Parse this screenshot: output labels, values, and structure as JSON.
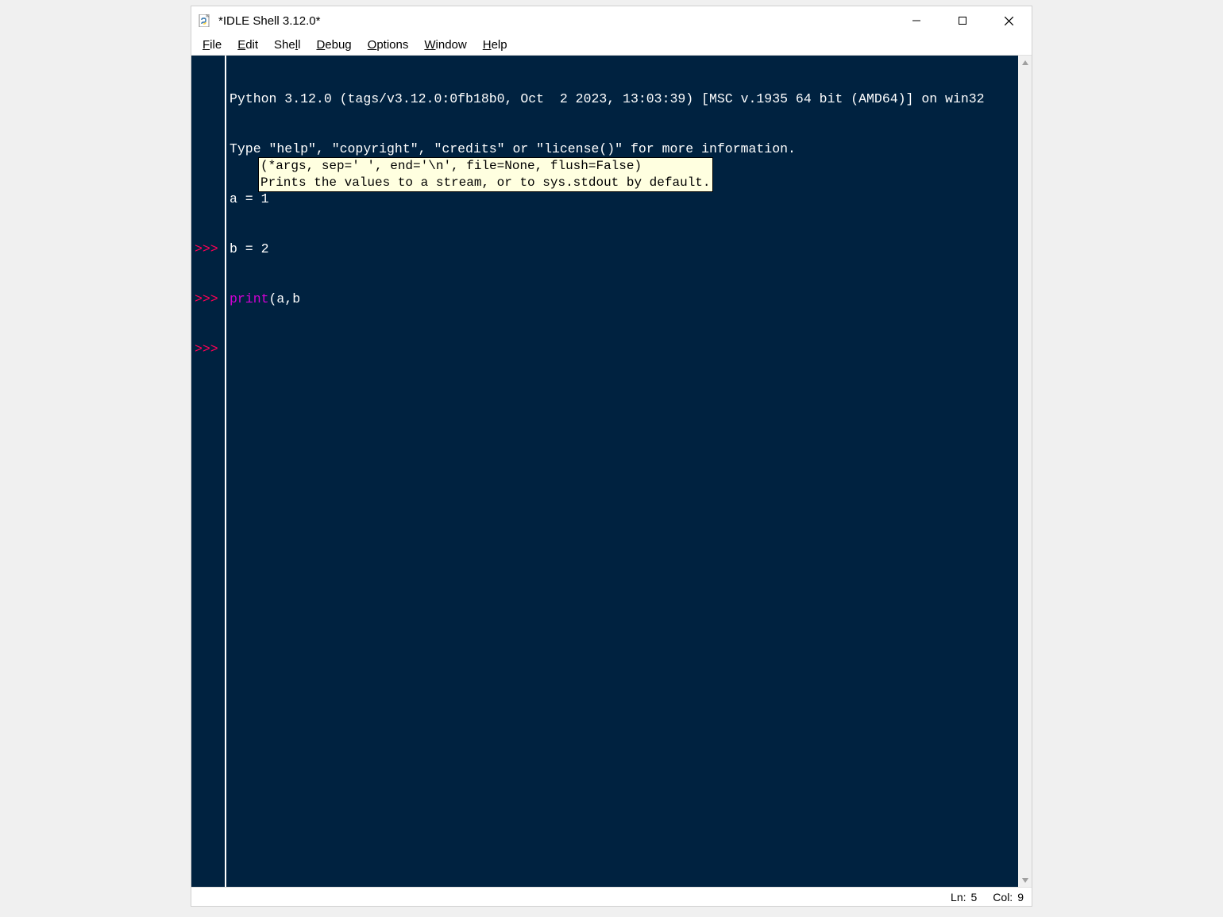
{
  "window": {
    "title": "*IDLE Shell 3.12.0*"
  },
  "menu": {
    "file": {
      "label": "File",
      "accel": "F"
    },
    "edit": {
      "label": "Edit",
      "accel": "E"
    },
    "shell": {
      "label": "Shell",
      "accel": "l"
    },
    "debug": {
      "label": "Debug",
      "accel": "D"
    },
    "options": {
      "label": "Options",
      "accel": "O"
    },
    "window": {
      "label": "Window",
      "accel": "W"
    },
    "help": {
      "label": "Help",
      "accel": "H"
    }
  },
  "shell": {
    "banner_line1": "Python 3.12.0 (tags/v3.12.0:0fb18b0, Oct  2 2023, 13:03:39) [MSC v.1935 64 bit (AMD64)] on win32",
    "banner_line2": "Type \"help\", \"copyright\", \"credits\" or \"license()\" for more information.",
    "prompt": ">>>",
    "lines": {
      "l1": "a = 1",
      "l2": "b = 2",
      "l3_builtin": "print",
      "l3_rest": "(a,b"
    }
  },
  "calltip": {
    "sig": "(*args, sep=' ', end='\\n', file=None, flush=False)",
    "doc": "Prints the values to a stream, or to sys.stdout by default."
  },
  "status": {
    "ln_label": "Ln:",
    "ln_value": "5",
    "col_label": "Col:",
    "col_value": "9"
  },
  "colors": {
    "shell_bg": "#002240",
    "prompt": "#ff0055",
    "builtin": "#d500d5",
    "tooltip_bg": "#ffffe0"
  }
}
